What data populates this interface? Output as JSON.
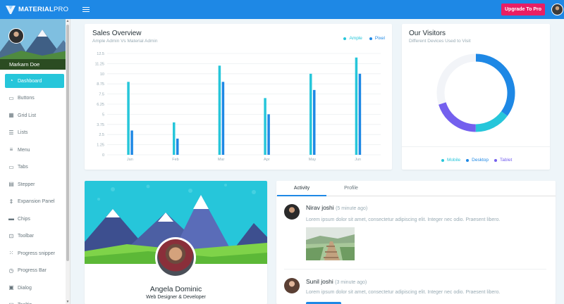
{
  "header": {
    "brand_bold": "MATERIAL",
    "brand_thin": "PRO",
    "upgrade_label": "Upgrade To Pro"
  },
  "sidebar": {
    "user_name": "Markarn Doe",
    "items": [
      {
        "label": "Dashboard",
        "icon": "dashboard-icon",
        "active": true
      },
      {
        "label": "Buttons",
        "icon": "buttons-icon"
      },
      {
        "label": "Grid List",
        "icon": "grid-icon"
      },
      {
        "label": "Lists",
        "icon": "list-icon"
      },
      {
        "label": "Menu",
        "icon": "menu-icon"
      },
      {
        "label": "Tabs",
        "icon": "tabs-icon"
      },
      {
        "label": "Stepper",
        "icon": "stepper-icon"
      },
      {
        "label": "Expansion Panel",
        "icon": "expansion-icon"
      },
      {
        "label": "Chips",
        "icon": "chips-icon"
      },
      {
        "label": "Toolbar",
        "icon": "toolbar-icon"
      },
      {
        "label": "Progress snipper",
        "icon": "progress-spinner-icon"
      },
      {
        "label": "Progress Bar",
        "icon": "progress-bar-icon"
      },
      {
        "label": "Dialog",
        "icon": "dialog-icon"
      },
      {
        "label": "Tooltip",
        "icon": "tooltip-icon"
      }
    ]
  },
  "sales": {
    "title": "Sales Overview",
    "subtitle": "Ample Admin Vs Material Admin",
    "legend": [
      "Ample",
      "Pixel"
    ]
  },
  "visitors": {
    "title": "Our Visitors",
    "subtitle": "Different Devices Used to Visit",
    "legend": [
      "Mobile",
      "Desktop",
      "Tablet"
    ]
  },
  "profile_card": {
    "name": "Angela Dominic",
    "role": "Web Designer & Developer"
  },
  "activity": {
    "tabs": [
      "Activity",
      "Profile"
    ],
    "items": [
      {
        "name": "Nirav joshi",
        "time": "(5 minute ago)",
        "text": "Lorem ipsum dolor sit amet, consectetur adipiscing elit. Integer nec odio. Praesent libero."
      },
      {
        "name": "Sunil joshi",
        "time": "(3 minute ago)",
        "text": "Lorem ipsum dolor sit amet, consectetur adipiscing elit. Integer nec odio. Praesent libero."
      }
    ]
  },
  "colors": {
    "primary": "#1e88e5",
    "accent": "#26c6da",
    "danger": "#e91e63",
    "tablet": "#7460ee",
    "ring_bg": "#f2f4f8"
  },
  "chart_data": [
    {
      "type": "bar",
      "title": "Sales Overview",
      "categories": [
        "Jan",
        "Feb",
        "Mar",
        "Apr",
        "May",
        "Jun"
      ],
      "series": [
        {
          "name": "Ample",
          "color": "#26c6da",
          "values": [
            9,
            4,
            11,
            7,
            10,
            12
          ]
        },
        {
          "name": "Pixel",
          "color": "#1e88e5",
          "values": [
            3,
            2,
            9,
            5,
            8,
            10
          ]
        }
      ],
      "ylim": [
        0,
        12.5
      ],
      "yticks": [
        "0",
        "1.25",
        "2.5",
        "3.75",
        "5",
        "6.25",
        "7.5",
        "8.75",
        "10",
        "11.25",
        "12.5"
      ],
      "grid": true,
      "legend": "top-right"
    },
    {
      "type": "pie",
      "title": "Our Visitors",
      "variant": "donut",
      "slices": [
        {
          "name": "Mobile",
          "value": 15,
          "color": "#26c6da"
        },
        {
          "name": "Desktop",
          "value": 35,
          "color": "#1e88e5"
        },
        {
          "name": "Tablet",
          "value": 20,
          "color": "#7460ee"
        }
      ],
      "remainder": 30,
      "legend": "bottom"
    }
  ]
}
